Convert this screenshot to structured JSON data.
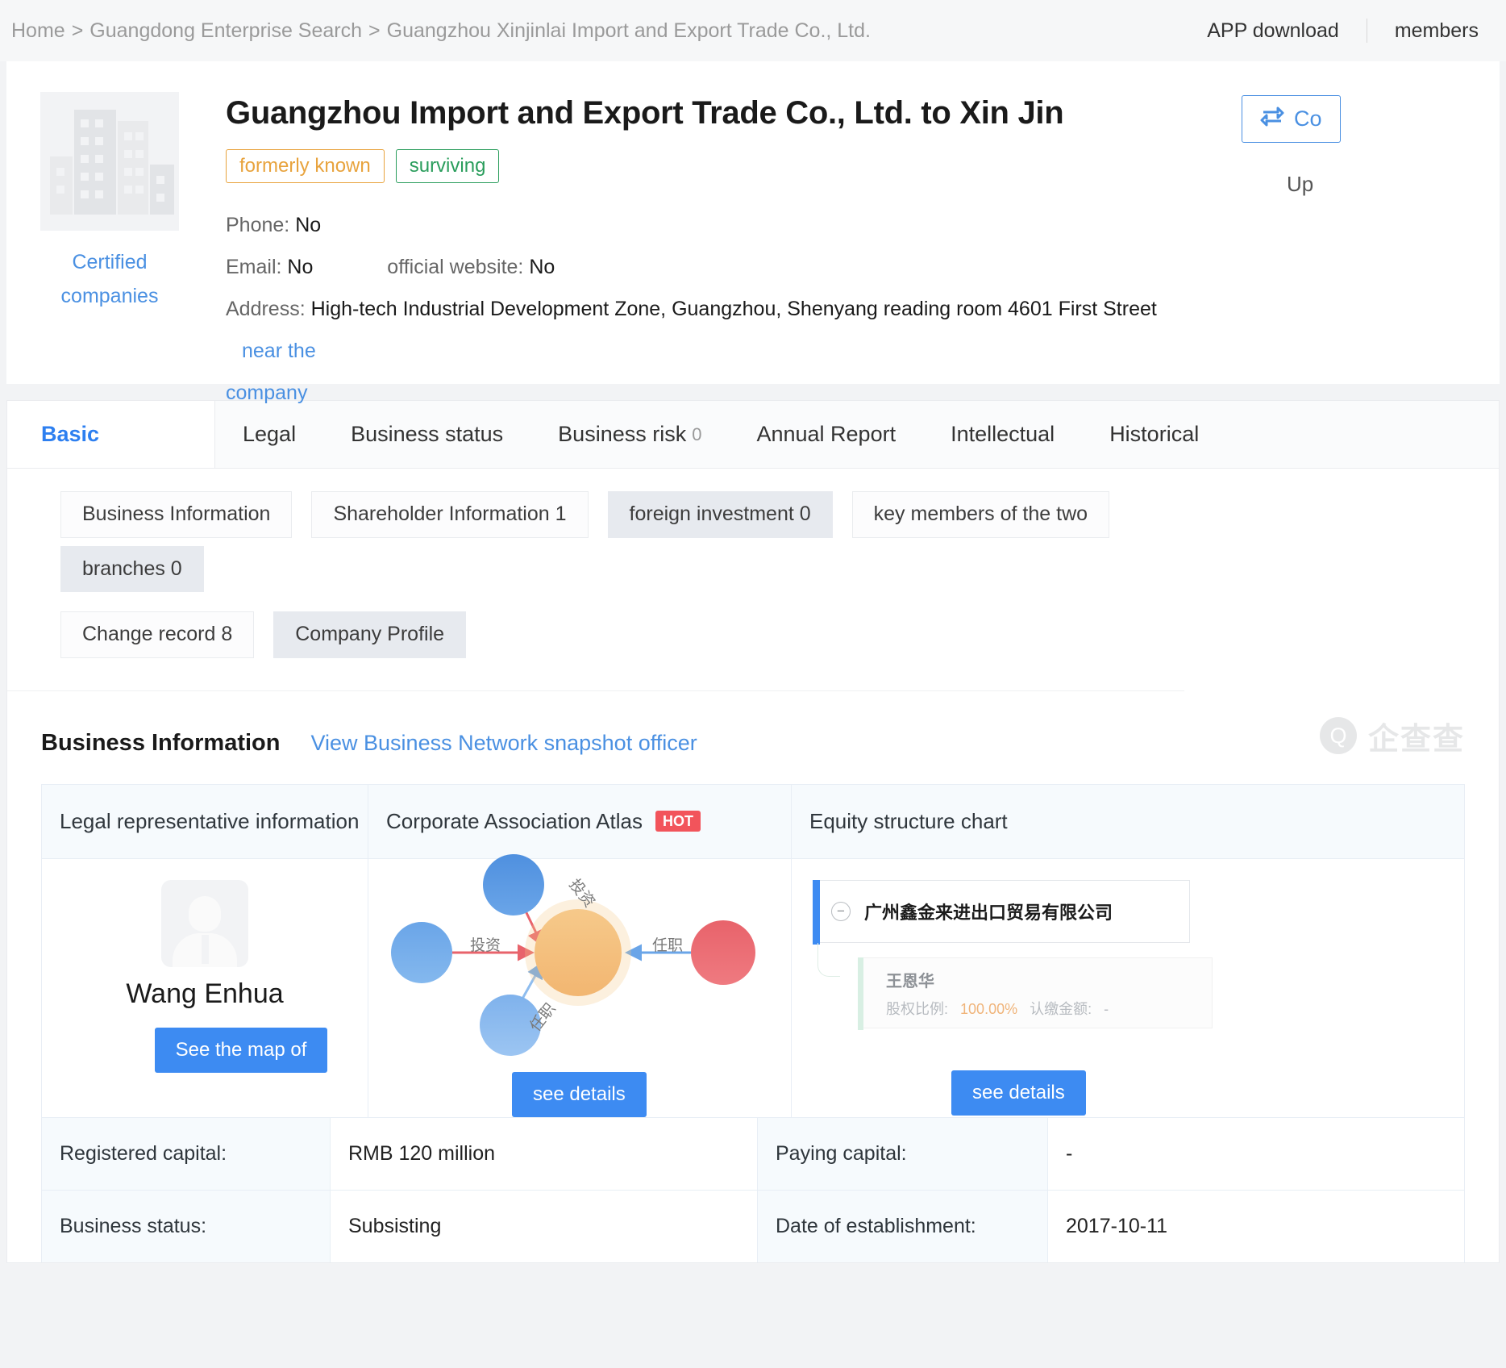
{
  "topbar": {
    "breadcrumb": [
      "Home",
      "Guangdong Enterprise Search",
      "Guangzhou Xinjinlai Import and Export Trade Co., Ltd."
    ],
    "separator": ">",
    "app_download": "APP download",
    "membership": "members"
  },
  "company": {
    "logo_caption_line1": "Certified",
    "logo_caption_line2": "companies",
    "title": "Guangzhou Import and Export Trade Co., Ltd. to Xin Jin",
    "tags": [
      {
        "label": "formerly known",
        "color": "#e8a33d"
      },
      {
        "label": "surviving",
        "color": "#2a9d5c"
      }
    ],
    "phone_label": "Phone:",
    "phone_value": "No",
    "email_label": "Email:",
    "email_value": "No",
    "website_label": "official website:",
    "website_value": "No",
    "address_label": "Address:",
    "address_value": "High-tech Industrial Development Zone, Guangzhou, Shenyang reading room 4601 First Street",
    "near_link": "near the",
    "near_link2": "company",
    "compare_button": "Co",
    "update_text": "Up"
  },
  "tabs": [
    {
      "label": "Basic",
      "count": "",
      "active": true
    },
    {
      "label": "Legal",
      "count": "",
      "active": false
    },
    {
      "label": "Business status",
      "count": "",
      "active": false
    },
    {
      "label": "Business risk",
      "count": "0",
      "active": false
    },
    {
      "label": "Annual Report",
      "count": "",
      "active": false
    },
    {
      "label": "Intellectual",
      "count": "",
      "active": false
    },
    {
      "label": "Historical",
      "count": "",
      "active": false
    }
  ],
  "subtabs": [
    {
      "label": "Business Information",
      "selected": false
    },
    {
      "label": "Shareholder Information 1",
      "selected": false
    },
    {
      "label": "foreign investment 0",
      "selected": true
    },
    {
      "label": "key members of the two",
      "selected": false
    },
    {
      "label": "branches 0",
      "selected": true
    },
    {
      "label": "Change record 8",
      "selected": false
    },
    {
      "label": "Company Profile",
      "selected": true
    }
  ],
  "business_section": {
    "title": "Business Information",
    "link": "View Business Network snapshot officer",
    "watermark_icon": "Q",
    "watermark_text": "企查查"
  },
  "cards": {
    "headers": [
      {
        "label": "Legal representative information",
        "badge": ""
      },
      {
        "label": "Corporate Association Atlas",
        "badge": "HOT"
      },
      {
        "label": "Equity structure chart",
        "badge": ""
      }
    ],
    "legal_rep": {
      "name": "Wang Enhua",
      "button": "See the map of"
    },
    "atlas": {
      "button": "see details",
      "edge_labels": [
        "投资",
        "投资",
        "任职",
        "任职"
      ]
    },
    "equity": {
      "company": "广州鑫金来进出口贸易有限公司",
      "person": "王恩华",
      "ratio_label": "股权比例:",
      "ratio_value": "100.00%",
      "amount_label": "认缴金额:",
      "amount_value": "-",
      "button": "see details"
    }
  },
  "details": [
    {
      "label1": "Registered capital:",
      "value1": "RMB 120 million",
      "label2": "Paying capital:",
      "value2": "-"
    },
    {
      "label1": "Business status:",
      "value1": "Subsisting",
      "label2": "Date of establishment:",
      "value2": "2017-10-11"
    }
  ]
}
